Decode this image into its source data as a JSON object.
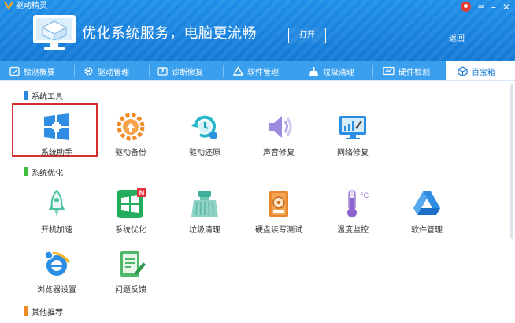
{
  "window": {
    "app_title": "驱动精灵",
    "slogan": "优化系统服务，电脑更流畅",
    "open_label": "打开",
    "back_label": "返回",
    "accent": "#1479d6"
  },
  "tabs": [
    {
      "label": "检测概要",
      "icon": "monitor-check-icon"
    },
    {
      "label": "驱动管理",
      "icon": "gear-icon"
    },
    {
      "label": "诊断修复",
      "icon": "wrench-icon"
    },
    {
      "label": "软件管理",
      "icon": "triangle-app-icon"
    },
    {
      "label": "垃圾清理",
      "icon": "broom-icon"
    },
    {
      "label": "硬件检测",
      "icon": "chart-monitor-icon"
    },
    {
      "label": "百宝箱",
      "icon": "cube-icon",
      "active": true
    }
  ],
  "sections": {
    "system_tools": {
      "title": "系统工具",
      "color": "#2b88e0"
    },
    "system_optimize": {
      "title": "系统优化",
      "color": "#3fbf3f"
    },
    "other": {
      "title": "其他推荐",
      "color": "#f08a24"
    }
  },
  "tools": {
    "system_helper": "系统助手",
    "driver_backup": "驱动备份",
    "driver_restore": "驱动还原",
    "sound_repair": "声音修复",
    "network_repair": "网络修复",
    "boot_speedup": "开机加速",
    "system_optimize": "系统优化",
    "junk_clean": "垃圾清理",
    "disk_test": "硬盘读写测试",
    "temp_monitor": "温度监控",
    "software_manage": "软件管理",
    "browser_settings": "浏览器设置",
    "feedback": "问题反馈"
  },
  "badges": {
    "system_optimize": "N"
  }
}
